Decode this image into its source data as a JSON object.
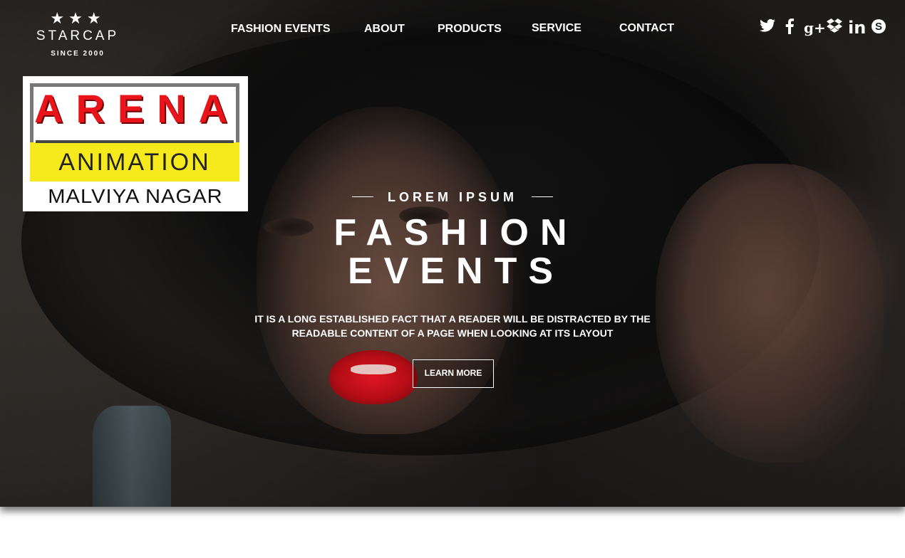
{
  "brand": {
    "stars": "★★★",
    "name": "STARCAP",
    "since": "SINCE 2000"
  },
  "nav": {
    "items": [
      {
        "label": "FASHION EVENTS"
      },
      {
        "label": "ABOUT"
      },
      {
        "label": "PRODUCTS"
      },
      {
        "label": "SERVICE"
      },
      {
        "label": "CONTACT"
      }
    ]
  },
  "social": {
    "icons": [
      {
        "name": "twitter-icon",
        "glyph": "t"
      },
      {
        "name": "facebook-icon",
        "glyph": "f"
      },
      {
        "name": "google-plus-icon",
        "glyph": "g+"
      },
      {
        "name": "dropbox-icon",
        "glyph": "❖"
      },
      {
        "name": "linkedin-icon",
        "glyph": "in"
      },
      {
        "name": "skype-icon",
        "glyph": "S"
      }
    ]
  },
  "watermark": {
    "line1": "ARENA",
    "line2": "ANIMATION",
    "line3": "MALVIYA NAGAR"
  },
  "hero": {
    "kicker": "LOREM IPSUM",
    "title_line1": "FASHION",
    "title_line2": "EVENTS",
    "subtitle_line1": "IT IS A LONG ESTABLISHED FACT THAT A READER WILL BE DISTRACTED BY THE",
    "subtitle_line2": "READABLE CONTENT OF A PAGE WHEN LOOKING AT ITS LAYOUT",
    "cta_label": "LEARN MORE"
  },
  "colors": {
    "accent_red": "#e8141a",
    "accent_yellow": "#f7ea1c",
    "text": "#ffffff"
  }
}
